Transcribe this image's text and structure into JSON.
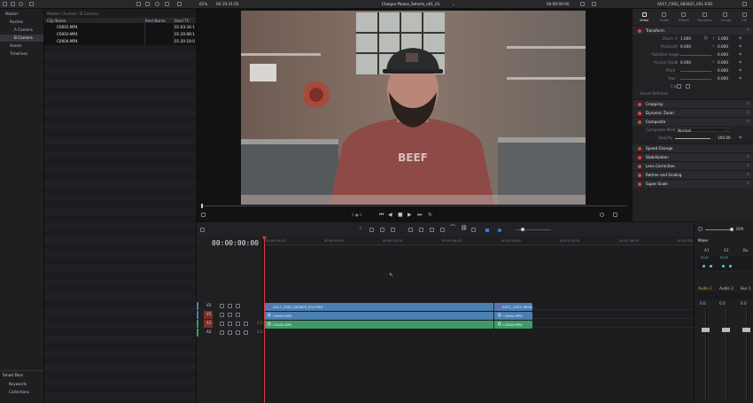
{
  "topbar": {
    "zoom": "61%",
    "timecode_left": "00:19:31:05",
    "title": "Cheque Please_Selects_v01_01",
    "timecode_right": "00:00:00:00",
    "clip_name": "A017_C002_082825_001.R3D"
  },
  "media_pool": {
    "tree": [
      {
        "label": "Master"
      },
      {
        "label": "Rushes"
      },
      {
        "label": "A Camera"
      },
      {
        "label": "B Camera"
      },
      {
        "label": "Assets"
      },
      {
        "label": "Timelines"
      }
    ],
    "smart_bins_title": "Smart Bins",
    "smart_bins": [
      {
        "label": "Keywords"
      },
      {
        "label": "Collections"
      }
    ],
    "breadcrumb": "Master / Rushes / B Camera",
    "columns": {
      "clip_name": "Clip Name",
      "reel_name": "Reel Name",
      "start_tc": "Start TC"
    },
    "clips": [
      {
        "name": "C0002.MP4",
        "tc": "01:03:34:1"
      },
      {
        "name": "C0003.MP4",
        "tc": "01:20:08:1"
      },
      {
        "name": "C0004.MP4",
        "tc": "01:20:18:0"
      }
    ]
  },
  "viewer": {
    "frame_counter": "0 ● 0"
  },
  "inspector": {
    "tabs": [
      "Video",
      "Audio",
      "Effects",
      "Transition",
      "Image",
      "File"
    ],
    "transform_title": "Transform",
    "zoom_label": "Zoom",
    "zoom_x": "1.000",
    "zoom_y": "1.000",
    "position_label": "Position",
    "position_x": "0.000",
    "position_y": "0.000",
    "rotation_label": "Rotation Angle",
    "rotation": "0.000",
    "anchor_label": "Anchor Point",
    "anchor_x": "0.000",
    "anchor_y": "0.000",
    "pitch_label": "Pitch",
    "pitch": "0.000",
    "yaw_label": "Yaw",
    "yaw": "0.000",
    "flip_label": "Flip",
    "smart_reframe": "Smart Reframe",
    "cropping": "Cropping",
    "dynamic_zoom": "Dynamic Zoom",
    "composite_title": "Composite",
    "composite_mode_label": "Composite Mode",
    "composite_mode": "Normal",
    "opacity_label": "Opacity",
    "opacity": "100.00",
    "sections": [
      "Speed Change",
      "Stabilization",
      "Lens Correction",
      "Retime and Scaling",
      "Super Scale"
    ]
  },
  "timeline": {
    "timecode": "00:00:00:00",
    "ruler": [
      "00:00:00:00",
      "00:00:10:00",
      "00:00:32:00",
      "00:00:48:00",
      "00:01:04:00",
      "00:01:20:00",
      "00:01:36:00",
      "00:01:52:0"
    ],
    "tracks": [
      {
        "name": "V2"
      },
      {
        "name": "V1"
      },
      {
        "name": "A1",
        "level": "2.0"
      },
      {
        "name": "A2",
        "level": "2.0"
      }
    ],
    "clips": {
      "v2_a": "A017_C002_082825_001.R3D",
      "v2_b": "A017_C003_0828...",
      "v1_a": "C0002.MP4",
      "v1_b": "C0004.MP4",
      "a1_a": "C0002.MP4",
      "a1_b": "C0004.MP4"
    }
  },
  "mixer": {
    "title": "Mixer",
    "dim": "DIM",
    "channels": [
      "A1",
      "A2",
      "Bu"
    ],
    "strips": [
      "Audio 1",
      "Audio 2",
      "Bus 1"
    ],
    "vals": [
      "0.0",
      "0.0",
      "0.0"
    ]
  },
  "colors": {
    "accent": "#e0433a",
    "video_clip": "#4c7fb0",
    "audio_clip": "#3e9a68",
    "playhead": "#d9393b"
  }
}
